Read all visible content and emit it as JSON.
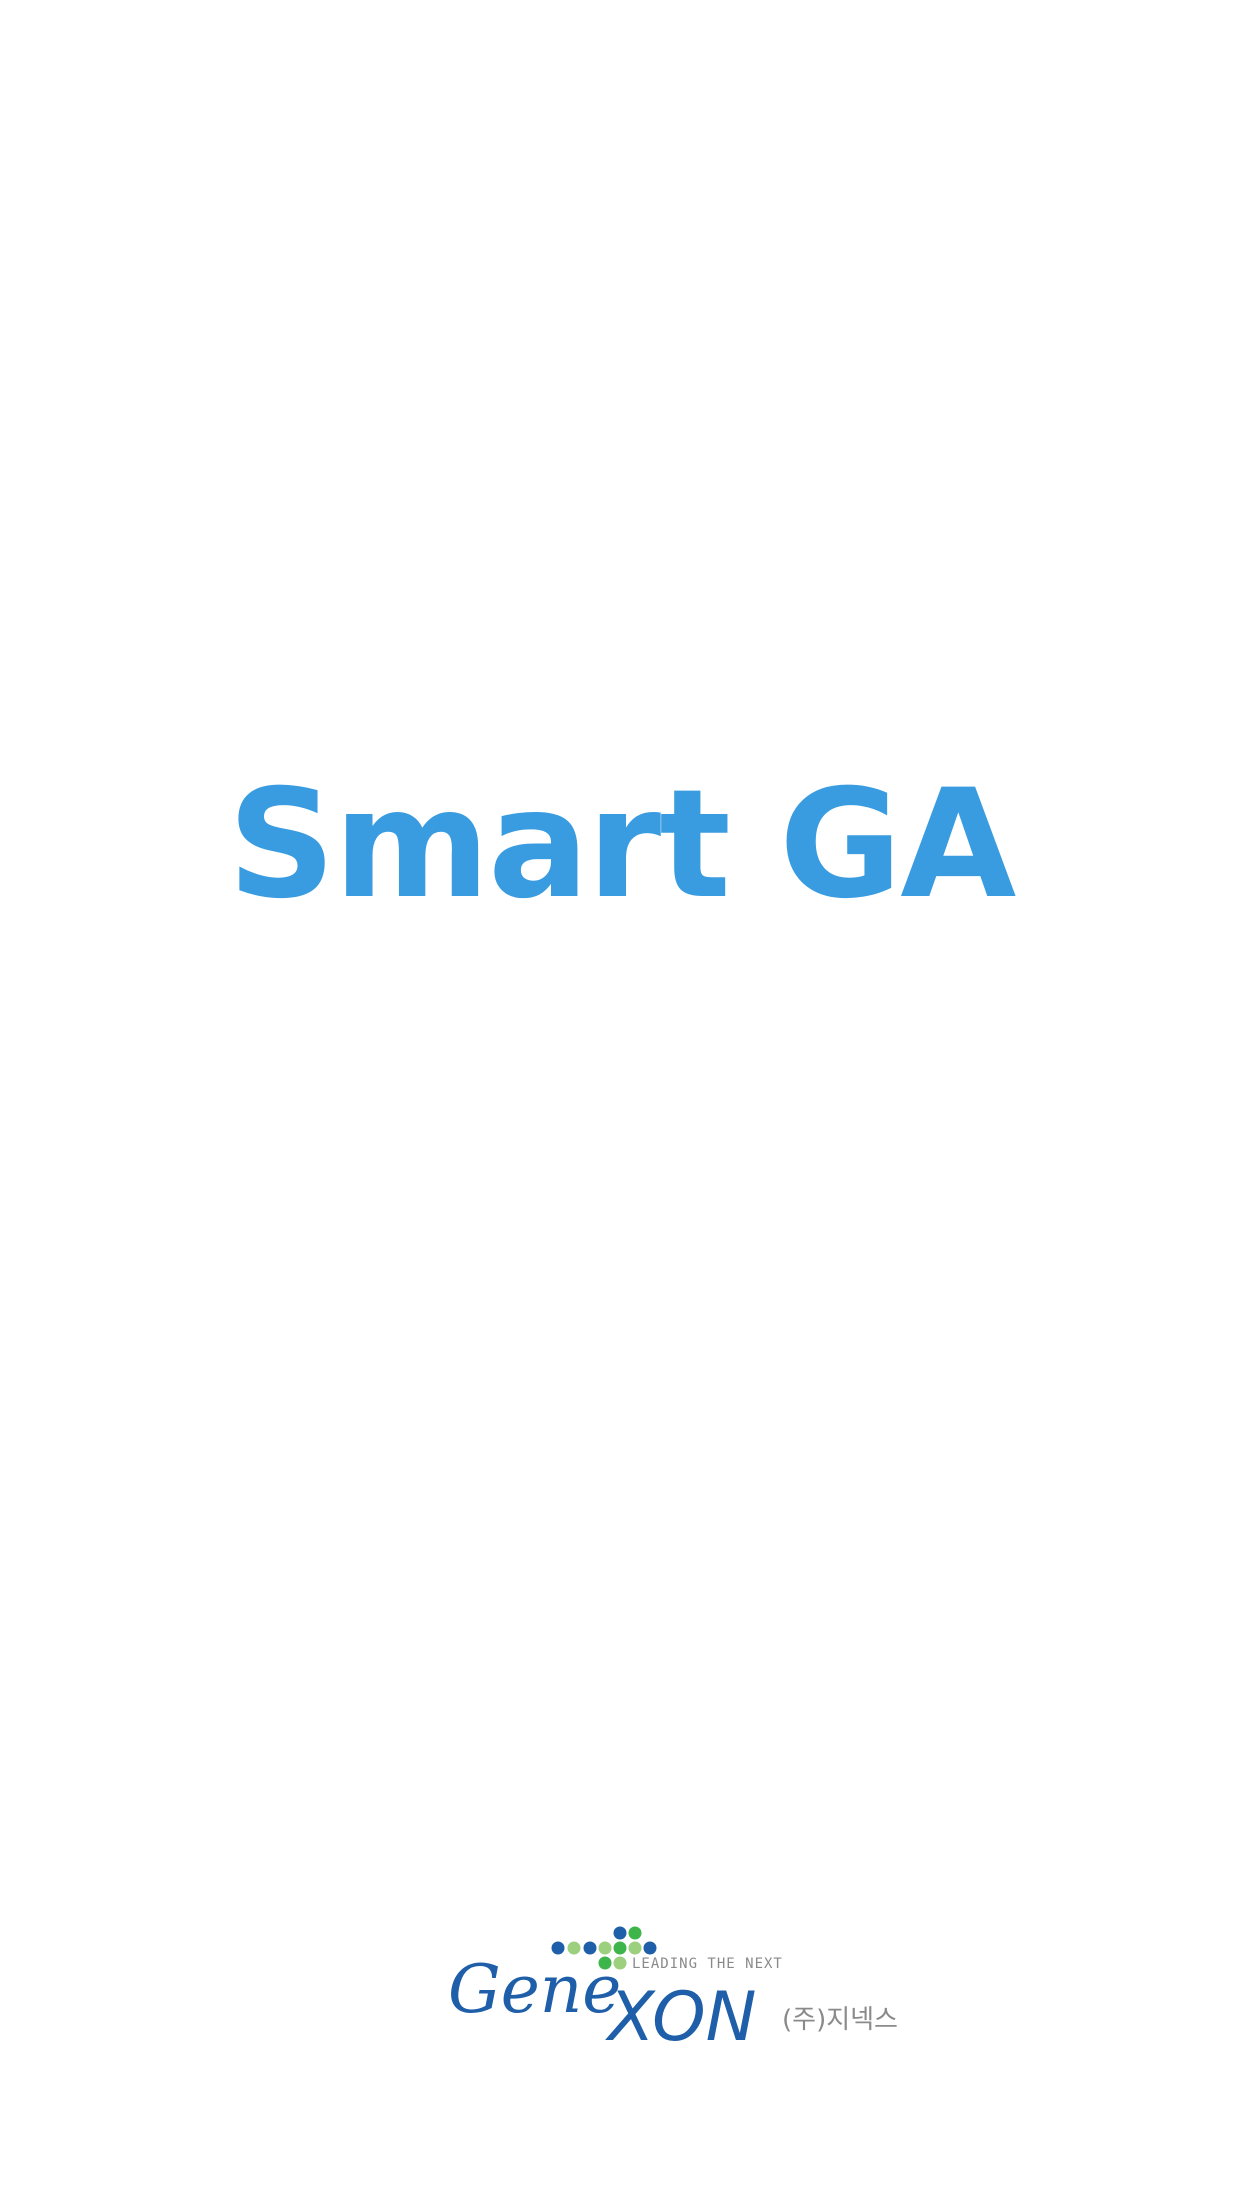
{
  "app": {
    "title": "Smart GA"
  },
  "brand": {
    "wordmark_script": "Gene",
    "wordmark_main": "XON",
    "tagline": "LEADING THE NEXT",
    "korean_name": "(주)지넥스"
  },
  "colors": {
    "title": "#3a9ce0",
    "brand_blue": "#1f5ea8",
    "dot_green": "#3db54a",
    "dot_light_green": "#9ccf7e",
    "tagline_gray": "#8a8a8a"
  }
}
